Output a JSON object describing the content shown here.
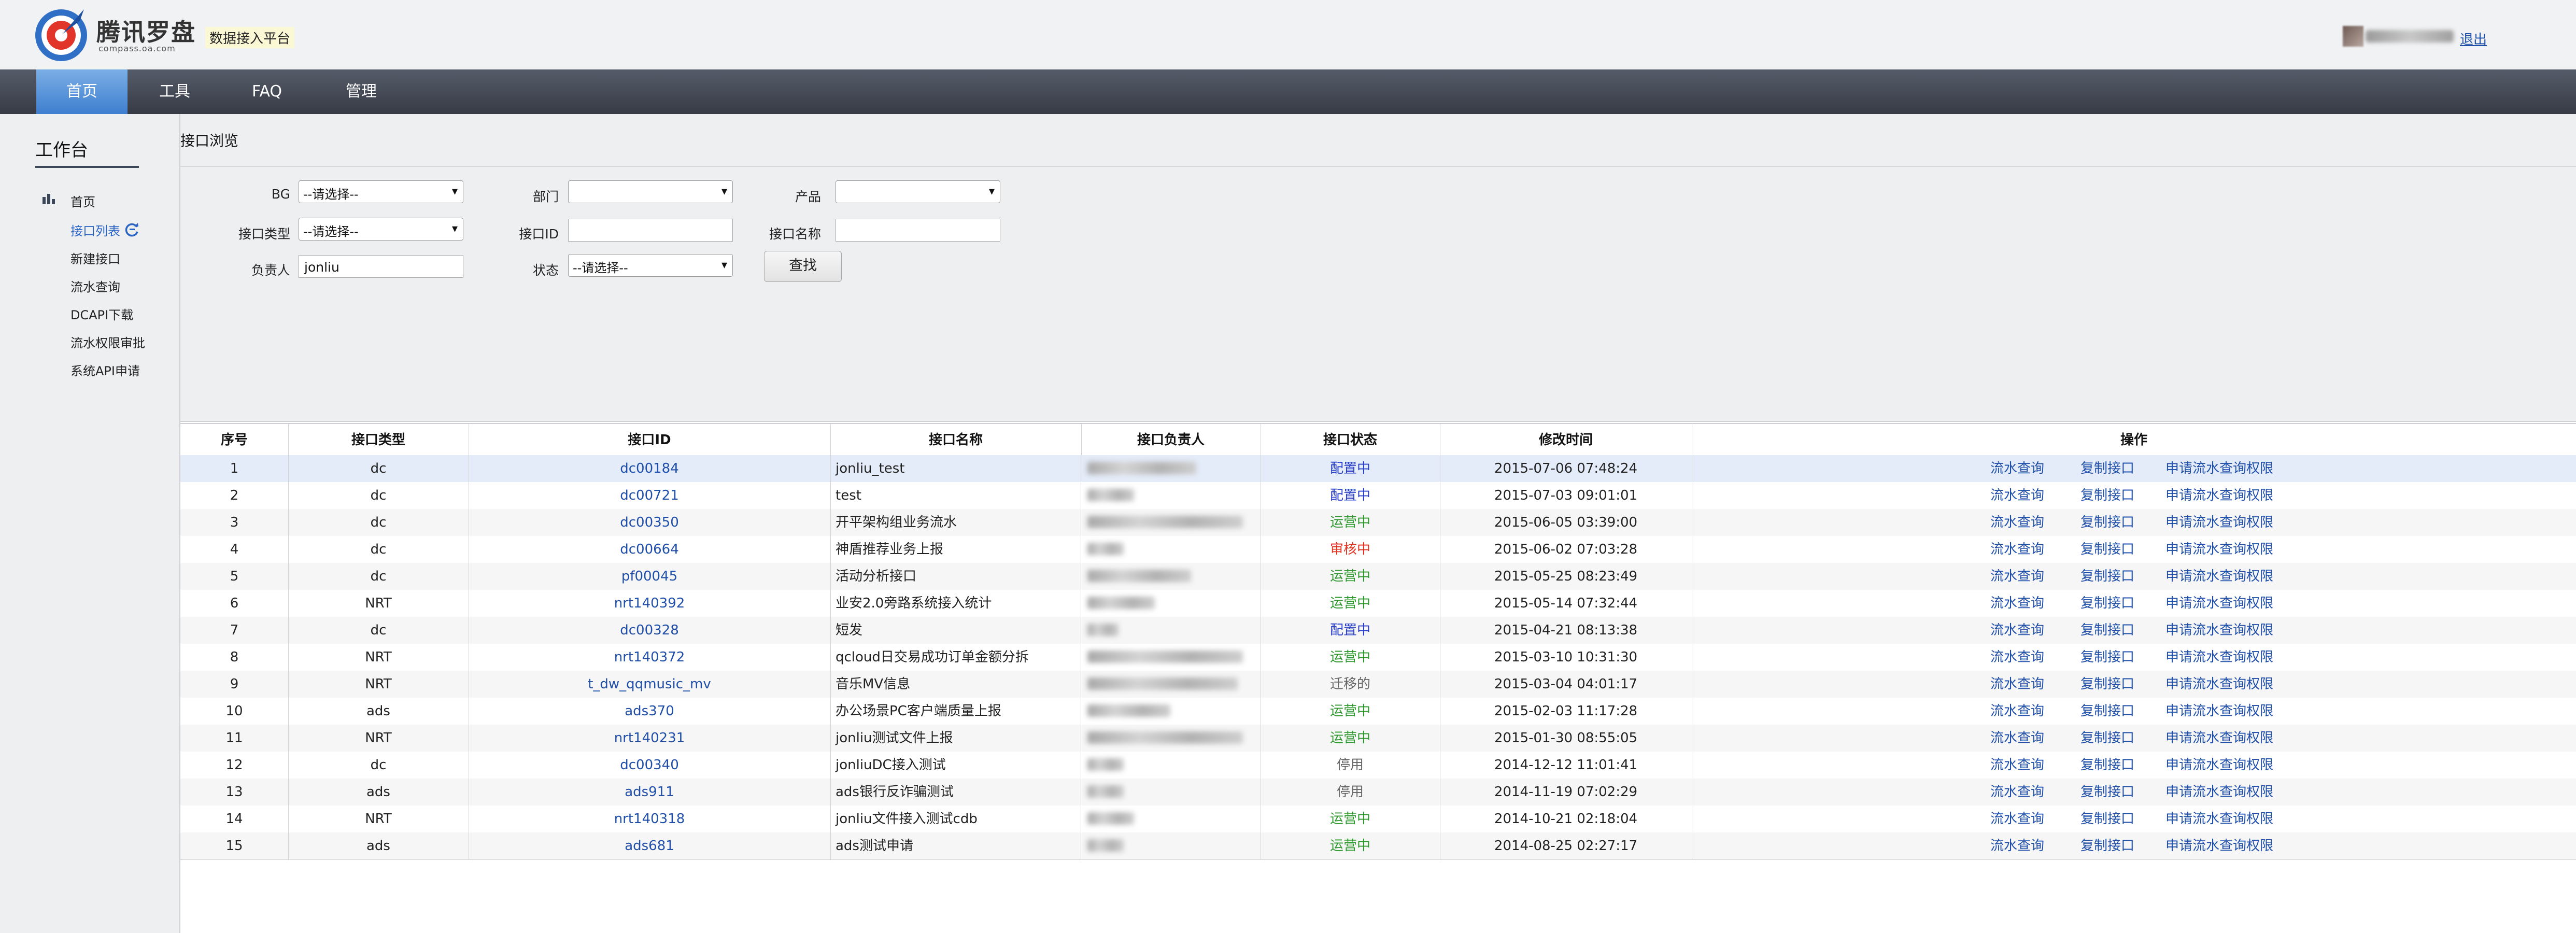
{
  "header": {
    "logo_text": "腾讯罗盘",
    "logo_sub": "compass.oa.com",
    "platform": "数据接入平台",
    "logout": "退出",
    "colors": {
      "nav_bg": "#3e434d",
      "nav_active": "#4f8bd6",
      "link": "#1f4fa8"
    }
  },
  "nav": [
    "首页",
    "工具",
    "FAQ",
    "管理"
  ],
  "sidebar": {
    "title": "工作台",
    "home": "首页",
    "items": [
      "接口列表",
      "新建接口",
      "流水查询",
      "DCAPI下载",
      "流水权限审批",
      "系统API申请"
    ]
  },
  "breadcrumb": "接口浏览",
  "filters": {
    "bg_label": "BG",
    "bg_value": "--请选择--",
    "dept_label": "部门",
    "dept_value": "",
    "product_label": "产品",
    "product_value": "",
    "type_label": "接口类型",
    "type_value": "--请选择--",
    "id_label": "接口ID",
    "id_value": "",
    "name_label": "接口名称",
    "name_value": "",
    "owner_label": "负责人",
    "owner_value": "jonliu",
    "status_label": "状态",
    "status_value": "--请选择--",
    "search_button": "查找"
  },
  "table": {
    "headers": [
      "序号",
      "接口类型",
      "接口ID",
      "接口名称",
      "接口负责人",
      "接口状态",
      "修改时间",
      "操作"
    ],
    "ops": [
      "流水查询",
      "复制接口",
      "申请流水查询权限"
    ],
    "rows": [
      {
        "no": "1",
        "type": "dc",
        "id": "dc00184",
        "name": "jonliu_test",
        "status": "配置中",
        "status_color": "#2a3fc9",
        "time": "2015-07-06 07:48:24"
      },
      {
        "no": "2",
        "type": "dc",
        "id": "dc00721",
        "name": "test",
        "status": "配置中",
        "status_color": "#2a3fc9",
        "time": "2015-07-03 09:01:01"
      },
      {
        "no": "3",
        "type": "dc",
        "id": "dc00350",
        "name": "开平架构组业务流水",
        "status": "运营中",
        "status_color": "#2e9a2e",
        "time": "2015-06-05 03:39:00"
      },
      {
        "no": "4",
        "type": "dc",
        "id": "dc00664",
        "name": "神盾推荐业务上报",
        "status": "审核中",
        "status_color": "#e0321e",
        "time": "2015-06-02 07:03:28"
      },
      {
        "no": "5",
        "type": "dc",
        "id": "pf00045",
        "name": "活动分析接口",
        "status": "运营中",
        "status_color": "#2e9a2e",
        "time": "2015-05-25 08:23:49"
      },
      {
        "no": "6",
        "type": "NRT",
        "id": "nrt140392",
        "name": "业安2.0旁路系统接入统计",
        "status": "运营中",
        "status_color": "#2e9a2e",
        "time": "2015-05-14 07:32:44"
      },
      {
        "no": "7",
        "type": "dc",
        "id": "dc00328",
        "name": "短发",
        "status": "配置中",
        "status_color": "#2a3fc9",
        "time": "2015-04-21 08:13:38"
      },
      {
        "no": "8",
        "type": "NRT",
        "id": "nrt140372",
        "name": "qcloud日交易成功订单金额分拆",
        "status": "运营中",
        "status_color": "#2e9a2e",
        "time": "2015-03-10 10:31:30"
      },
      {
        "no": "9",
        "type": "NRT",
        "id": "t_dw_qqmusic_mv",
        "name": "音乐MV信息",
        "status": "迁移的",
        "status_color": "#666666",
        "time": "2015-03-04 04:01:17"
      },
      {
        "no": "10",
        "type": "ads",
        "id": "ads370",
        "name": "办公场景PC客户端质量上报",
        "status": "运营中",
        "status_color": "#2e9a2e",
        "time": "2015-02-03 11:17:28"
      },
      {
        "no": "11",
        "type": "NRT",
        "id": "nrt140231",
        "name": "jonliu测试文件上报",
        "status": "运营中",
        "status_color": "#2e9a2e",
        "time": "2015-01-30 08:55:05"
      },
      {
        "no": "12",
        "type": "dc",
        "id": "dc00340",
        "name": "jonliuDC接入测试",
        "status": "停用",
        "status_color": "#666666",
        "time": "2014-12-12 11:01:41"
      },
      {
        "no": "13",
        "type": "ads",
        "id": "ads911",
        "name": "ads银行反诈骗测试",
        "status": "停用",
        "status_color": "#666666",
        "time": "2014-11-19 07:02:29"
      },
      {
        "no": "14",
        "type": "NRT",
        "id": "nrt140318",
        "name": "jonliu文件接入测试cdb",
        "status": "运营中",
        "status_color": "#2e9a2e",
        "time": "2014-10-21 02:18:04"
      },
      {
        "no": "15",
        "type": "ads",
        "id": "ads681",
        "name": "ads测试申请",
        "status": "运营中",
        "status_color": "#2e9a2e",
        "time": "2014-08-25 02:27:17"
      }
    ]
  }
}
